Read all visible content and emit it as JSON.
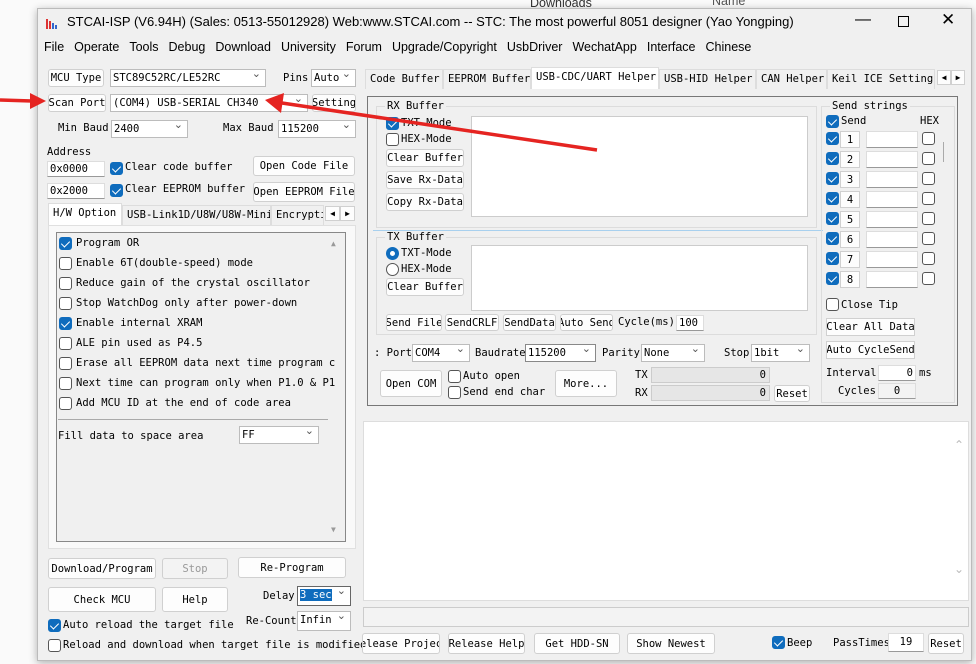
{
  "background": {
    "explorer_item": "Downloads",
    "column": "Name"
  },
  "window": {
    "title": "STCAI-ISP (V6.94H) (Sales: 0513-55012928) Web:www.STCAI.com  -- STC: The most powerful 8051 designer (Yao Yongping)",
    "controls": [
      "minimize-icon",
      "maximize-icon",
      "close-icon"
    ]
  },
  "menu": [
    "File",
    "Operate",
    "Tools",
    "Debug",
    "Download",
    "University",
    "Forum",
    "Upgrade/Copyright",
    "UsbDriver",
    "WechatApp",
    "Interface",
    "Chinese"
  ],
  "left": {
    "mcu_type_label": "MCU Type",
    "mcu_type": "STC89C52RC/LE52RC",
    "pins_label": "Pins",
    "pins": "Auto",
    "scan_port": "Scan Port",
    "port": "(COM4) USB-SERIAL CH340",
    "setting": "Setting",
    "min_baud_label": "Min Baud",
    "min_baud": "2400",
    "max_baud_label": "Max Baud",
    "max_baud": "115200",
    "address_label": "Address",
    "addr1": "0x0000",
    "addr2": "0x2000",
    "clear_code": "Clear code buffer",
    "clear_eeprom": "Clear EEPROM buffer",
    "open_code": "Open Code File",
    "open_eeprom": "Open EEPROM File",
    "tabs": [
      "H/W Option",
      "USB-Link1D/U8W/U8W-Mini",
      "Encrypti"
    ],
    "options": [
      {
        "label": "Program OR",
        "checked": true
      },
      {
        "label": "Enable 6T(double-speed) mode",
        "checked": false
      },
      {
        "label": "Reduce gain of the crystal oscillator",
        "checked": false
      },
      {
        "label": "Stop WatchDog only after power-down",
        "checked": false
      },
      {
        "label": "Enable internal XRAM",
        "checked": true
      },
      {
        "label": "ALE pin used as P4.5",
        "checked": false
      },
      {
        "label": "Erase all EEPROM data next time program c",
        "checked": false
      },
      {
        "label": "Next time can program only when P1.0 & P1",
        "checked": false
      },
      {
        "label": "Add MCU ID at the end of code area",
        "checked": false
      }
    ],
    "fill_label": "Fill data to space area",
    "fill_value": "FF",
    "download": "Download/Program",
    "stop": "Stop",
    "reprogram": "Re-Program",
    "check_mcu": "Check MCU",
    "help": "Help",
    "delay_label": "Delay",
    "delay": "3 sec",
    "recount_label": "Re-Count",
    "recount": "Infin",
    "auto_reload": "Auto reload the target file",
    "reload_download": "Reload and download when target file is modified"
  },
  "right": {
    "tabs": [
      "Code Buffer",
      "EEPROM Buffer",
      "USB-CDC/UART Helper",
      "USB-HID Helper",
      "CAN Helper",
      "Keil ICE Settings"
    ],
    "active_tab": "USB-CDC/UART Helper",
    "rx": {
      "title": "RX Buffer",
      "txt": "TXT-Mode",
      "hex": "HEX-Mode",
      "clear": "Clear Buffer",
      "save": "Save Rx-Data",
      "copy": "Copy Rx-Data"
    },
    "tx": {
      "title": "TX Buffer",
      "txt": "TXT-Mode",
      "hex": "HEX-Mode",
      "clear": "Clear Buffer",
      "send_file": "Send File",
      "send_crlf": "SendCRLF",
      "send_data": "SendData",
      "auto_send": "Auto Send",
      "cycle_label": "Cycle(ms)",
      "cycle": "100"
    },
    "serial": {
      "port_label": ": Port",
      "port": "COM4",
      "baud_label": "Baudrate",
      "baud": "115200",
      "parity_label": "Parity",
      "parity": "None",
      "stop_label": "Stop",
      "stop": "1bit",
      "open": "Open COM",
      "auto_open": "Auto open",
      "send_end": "Send end char",
      "more": "More...",
      "tx_label": "TX",
      "tx": "0",
      "rx_label": "RX",
      "rx": "0",
      "reset": "Reset"
    },
    "send_strings": {
      "title": "Send strings",
      "send": "Send",
      "hex": "HEX",
      "rows": [
        "1",
        "2",
        "3",
        "4",
        "5",
        "6",
        "7",
        "8"
      ],
      "close_tip": "Close Tip",
      "clear_all": "Clear All Data",
      "auto_cycle": "Auto CycleSend",
      "interval_label": "Interval",
      "interval": "0",
      "ms": "ms",
      "cycles_label": "Cycles",
      "cycles": "0"
    },
    "bottom": {
      "release_project": "elease Projec",
      "release_help": "Release Help",
      "get_hdd": "Get HDD-SN",
      "show_newest": "Show Newest",
      "beep": "Beep",
      "pass_label": "PassTimes",
      "pass": "19",
      "reset": "Reset"
    }
  },
  "colors": {
    "accent": "#0f6cbd",
    "annotation_arrow": "#e52421"
  }
}
